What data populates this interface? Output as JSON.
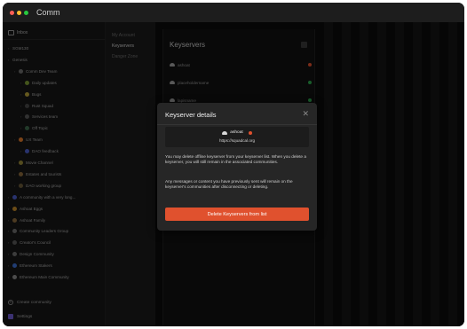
{
  "app": {
    "title": "Comm"
  },
  "window_controls": {
    "colors": [
      "#ff5f56",
      "#ffbd2e",
      "#27c93f"
    ]
  },
  "sidebar": {
    "inbox_label": "Inbox",
    "items": [
      {
        "label": "SGM130",
        "indent": 0,
        "dot": ""
      },
      {
        "label": "Genesis",
        "indent": 0,
        "dot": ""
      },
      {
        "label": "Comm Dev Team",
        "indent": 1,
        "dot": "#6e6e6e"
      },
      {
        "label": "Daily updates",
        "indent": 2,
        "dot": "#7c9b34"
      },
      {
        "label": "Bugs",
        "indent": 2,
        "dot": "#b8a23a"
      },
      {
        "label": "Rust Squad",
        "indent": 2,
        "dot": "#4a4a4a"
      },
      {
        "label": "Services team",
        "indent": 2,
        "dot": "#5a5a5a"
      },
      {
        "label": "Off Topic",
        "indent": 2,
        "dot": "#3f6b4d"
      },
      {
        "label": "UX Team",
        "indent": 1,
        "dot": "#e07b2c"
      },
      {
        "label": "DAO feedback",
        "indent": 2,
        "dot": "#4b5ec9"
      },
      {
        "label": "Movie Channel",
        "indent": 1,
        "dot": "#9a8a3a"
      },
      {
        "label": "Estates and tourists",
        "indent": 1,
        "dot": "#8b6b3c"
      },
      {
        "label": "DAO working group",
        "indent": 1,
        "dot": "#6b5a3a"
      },
      {
        "label": "A community with a very long...",
        "indent": 0,
        "dot": "#4b5ec9"
      },
      {
        "label": "Ashoat Eggs",
        "indent": 0,
        "dot": "#c48a2a"
      },
      {
        "label": "Ashoat Family",
        "indent": 0,
        "dot": "#8b6b3c"
      },
      {
        "label": "Community Leaders Group",
        "indent": 0,
        "dot": "#6e6e6e"
      },
      {
        "label": "Creator's Council",
        "indent": 0,
        "dot": "#5a5a5a"
      },
      {
        "label": "Design Community",
        "indent": 0,
        "dot": "#6e6e6e"
      },
      {
        "label": "Ethereum Stakers",
        "indent": 0,
        "dot": "#3d6fd1"
      },
      {
        "label": "Ethereum Main Community",
        "indent": 0,
        "dot": "#8a8a8a"
      }
    ],
    "create_community_label": "Create community",
    "settings_label": "Settings"
  },
  "subnav": {
    "items": [
      {
        "label": "My Account",
        "active": false
      },
      {
        "label": "Keyservers",
        "active": true
      },
      {
        "label": "Danger Zone",
        "active": false
      }
    ]
  },
  "keyservers_panel": {
    "title": "Keyservers",
    "rows": [
      {
        "label": "ashoat",
        "status_color": "#e0512e"
      },
      {
        "label": "placeholdername",
        "status_color": "#2fa84f"
      },
      {
        "label": "lapisname",
        "status_color": "#2fa84f"
      },
      {
        "label": "",
        "status_color": "#2fa84f"
      }
    ]
  },
  "modal": {
    "title": "Keyserver details",
    "keyserver_name": "ashoat",
    "keyserver_status_color": "#e0512e",
    "keyserver_url": "https://squadcal.org",
    "paragraph1": "You may delete offline keyserver from your keyserver list. When you delete a keyserver, you will still remain in the associated communities.",
    "paragraph2": "Any messages or content you have previously sent will remain on the keyserver's communities after disconnecting or deleting.",
    "delete_button_label": "Delete Keyservers from list"
  },
  "colors": {
    "accent_red": "#e0512e",
    "online_green": "#2fa84f",
    "background": "#0e0e0e"
  }
}
